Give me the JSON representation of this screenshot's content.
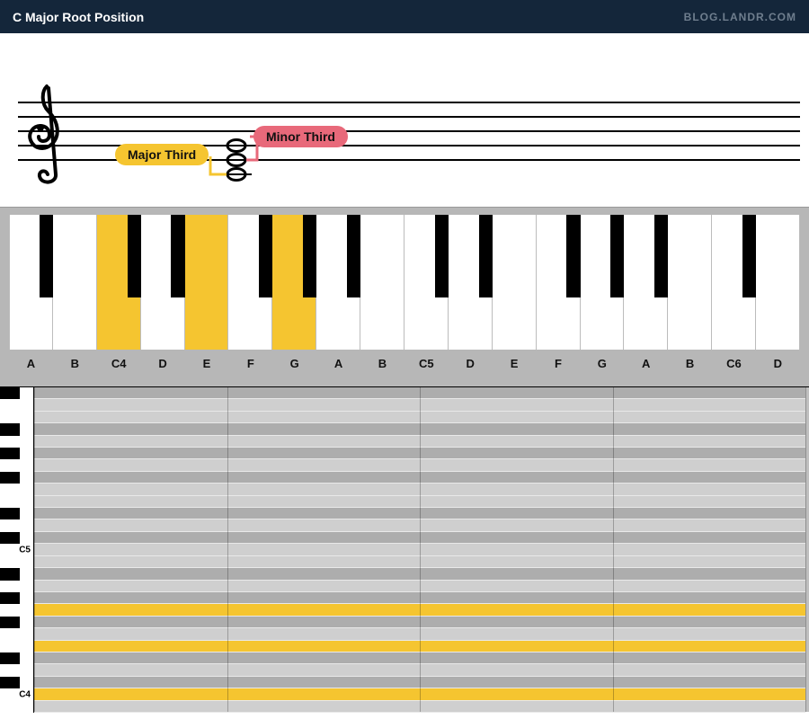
{
  "header": {
    "title": "C Major Root Position",
    "brand": "BLOG.LANDR.COM"
  },
  "intervals": {
    "major": "Major Third",
    "minor": "Minor Third"
  },
  "chord_notes": [
    "C4",
    "E",
    "G"
  ],
  "keyboard": {
    "white_labels": [
      "A",
      "B",
      "C4",
      "D",
      "E",
      "F",
      "G",
      "A",
      "B",
      "C5",
      "D",
      "E",
      "F",
      "G",
      "A",
      "B",
      "C6",
      "D"
    ],
    "highlighted_indices": [
      2,
      4,
      6
    ]
  },
  "roll": {
    "gutter_labels": {
      "C5": "C5",
      "C4": "C4"
    }
  }
}
